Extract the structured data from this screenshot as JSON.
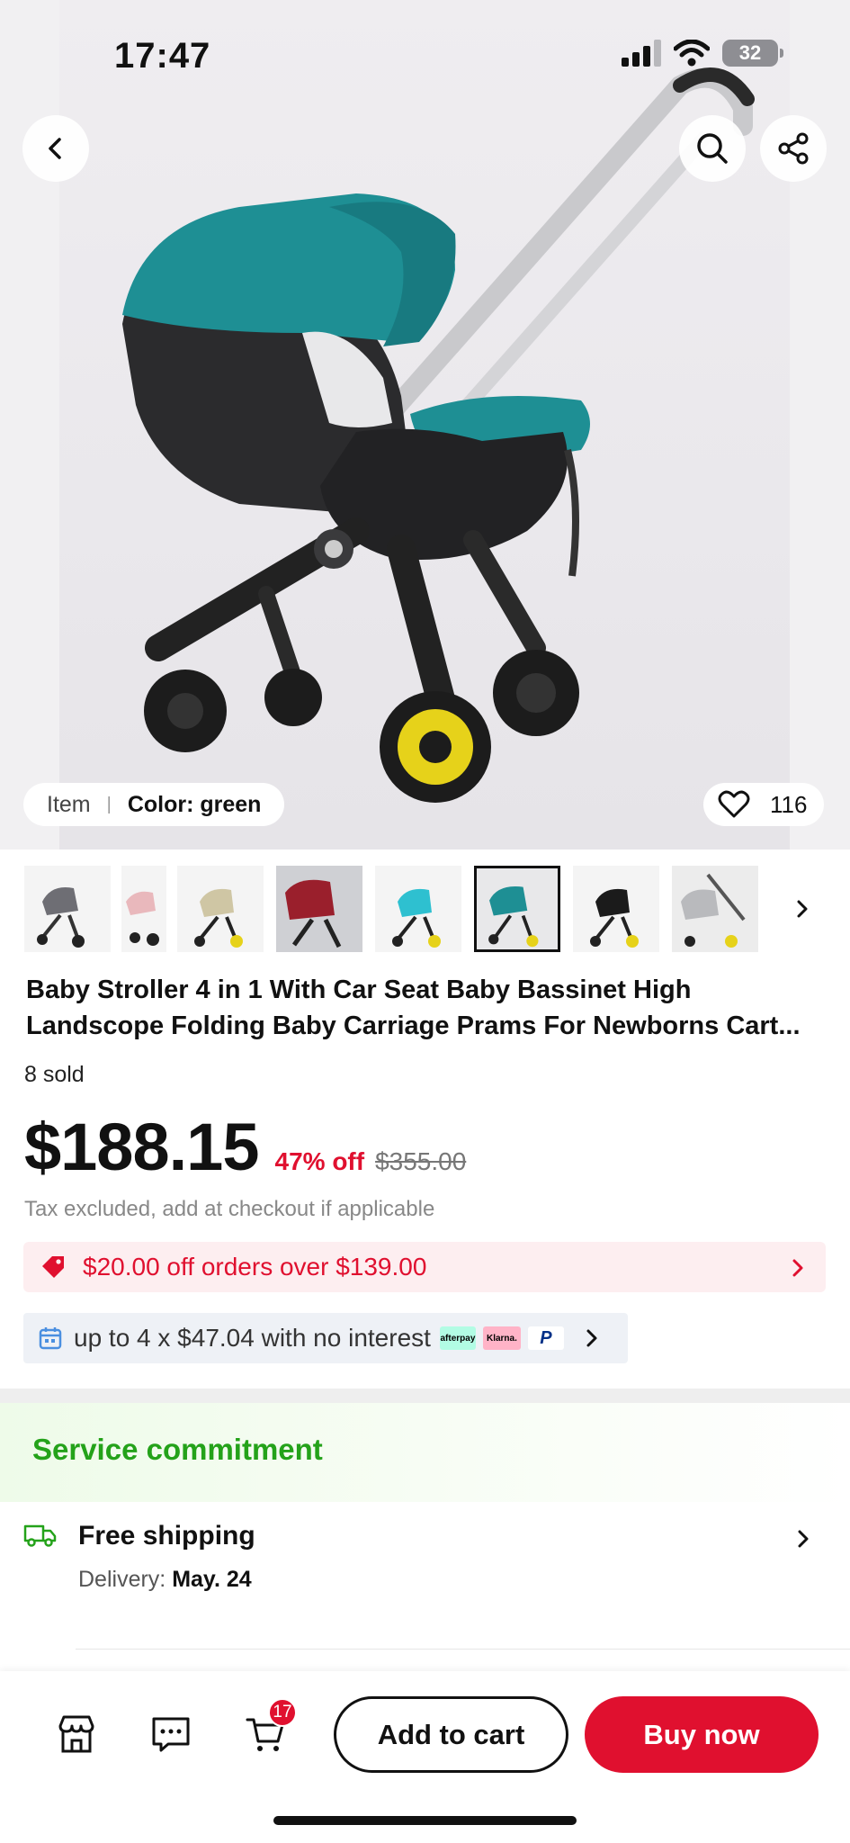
{
  "status_bar": {
    "time": "17:47",
    "battery": "32"
  },
  "gallery": {
    "item_label": "Item",
    "color_label": "Color: green",
    "like_count": "116"
  },
  "product": {
    "title": "Baby Stroller 4 in 1 With Car Seat Baby Bassinet High Landscope Folding Baby Carriage Prams For Newborns Cart...",
    "sold": "8 sold",
    "price": "$188.15",
    "discount": "47% off",
    "original_price": "$355.00",
    "tax_note": "Tax excluded, add at checkout if applicable"
  },
  "coupon": {
    "text": "$20.00 off orders over $139.00"
  },
  "installment": {
    "text": "up to 4 x $47.04 with no interest",
    "badges": {
      "afterpay": "afterpay",
      "klarna": "Klarna.",
      "paypal": "P"
    }
  },
  "service": {
    "title": "Service commitment",
    "shipping_title": "Free shipping",
    "delivery_label": "Delivery: ",
    "delivery_date": "May. 24"
  },
  "bottom_bar": {
    "cart_count": "17",
    "add_to_cart": "Add to cart",
    "buy_now": "Buy now"
  },
  "colors": {
    "accent_red": "#e0102f",
    "service_green": "#24a21a",
    "stroller_teal": "#1e8f94"
  }
}
